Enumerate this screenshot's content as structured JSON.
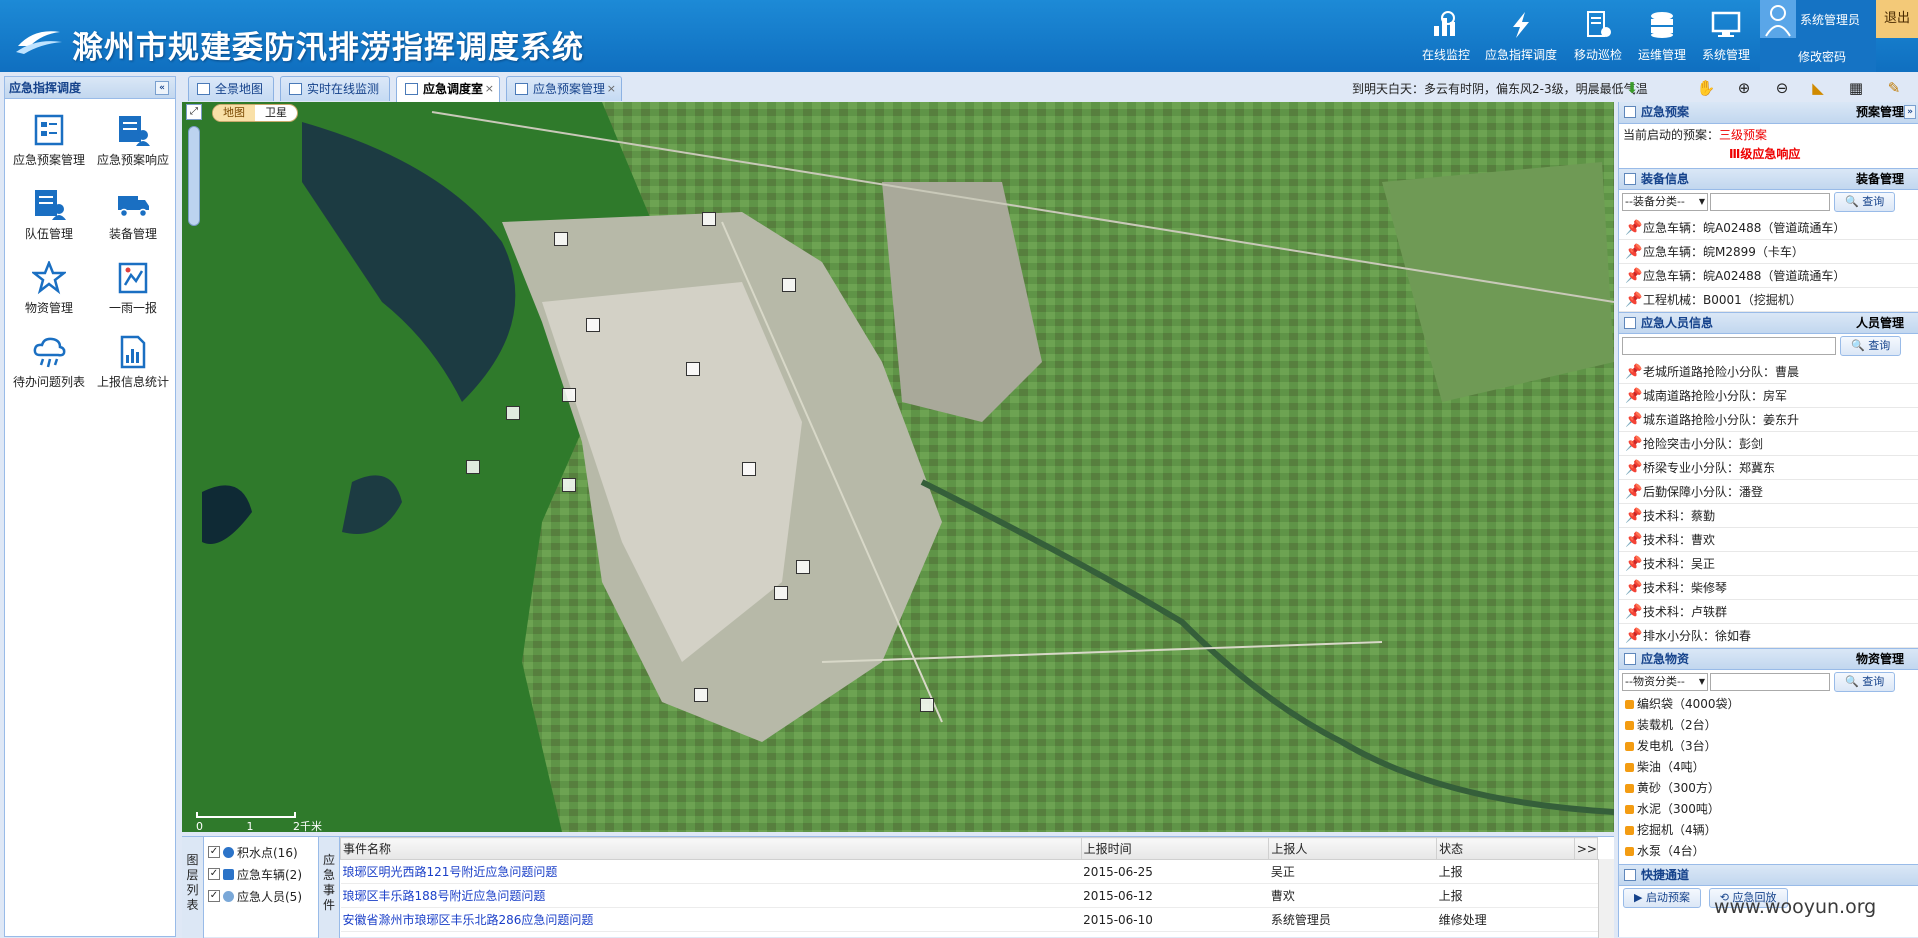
{
  "header": {
    "title": "滁州市规建委防汛排涝指挥调度系统",
    "nav": [
      {
        "label": "在线监控",
        "icon": "monitor-chart-icon"
      },
      {
        "label": "应急指挥调度",
        "icon": "lightning-icon"
      },
      {
        "label": "移动巡检",
        "icon": "mobile-inspect-icon"
      },
      {
        "label": "运维管理",
        "icon": "database-icon"
      },
      {
        "label": "系统管理",
        "icon": "computer-icon"
      }
    ],
    "user": "系统管理员",
    "change_password": "修改密码",
    "logout": "退出"
  },
  "left_panel": {
    "title": "应急指挥调度",
    "items": [
      {
        "label": "应急预案管理",
        "icon": "plan-doc-icon"
      },
      {
        "label": "应急预案响应",
        "icon": "plan-response-icon"
      },
      {
        "label": "队伍管理",
        "icon": "team-icon"
      },
      {
        "label": "装备管理",
        "icon": "truck-icon"
      },
      {
        "label": "物资管理",
        "icon": "star-icon"
      },
      {
        "label": "一雨一报",
        "icon": "rain-report-icon"
      },
      {
        "label": "待办问题列表",
        "icon": "cloud-rain-icon"
      },
      {
        "label": "上报信息统计",
        "icon": "stats-chart-icon"
      }
    ]
  },
  "tabs": [
    {
      "label": "全景地图",
      "closable": false
    },
    {
      "label": "实时在线监测",
      "closable": false
    },
    {
      "label": "应急调度室",
      "closable": true,
      "active": true
    },
    {
      "label": "应急预案管理",
      "closable": true
    }
  ],
  "weather": "到明天白天：多云有时阴，偏东风2-3级，明晨最低气温",
  "map": {
    "toggle": [
      "地图",
      "卫星"
    ],
    "active_toggle": "地图",
    "scale_labels": [
      "0",
      "1",
      "2千米"
    ]
  },
  "bottom": {
    "layer_title": "图层列表",
    "layers": [
      {
        "label": "积水点(16)",
        "checked": true
      },
      {
        "label": "应急车辆(2)",
        "checked": true
      },
      {
        "label": "应急人员(5)",
        "checked": true
      }
    ],
    "event_title": "应急事件",
    "columns": [
      "事件名称",
      "上报时间",
      "上报人",
      "状态",
      ">>"
    ],
    "rows": [
      {
        "name": "琅琊区明光西路121号附近应急问题问题",
        "time": "2015-06-25",
        "reporter": "吴正",
        "status": "上报"
      },
      {
        "name": "琅琊区丰乐路188号附近应急问题问题",
        "time": "2015-06-12",
        "reporter": "曹欢",
        "status": "上报"
      },
      {
        "name": "安徽省滁州市琅琊区丰乐北路286应急问题问题",
        "time": "2015-06-10",
        "reporter": "系统管理员",
        "status": "维修处理"
      }
    ]
  },
  "right_panel": {
    "plan": {
      "title": "应急预案",
      "link": "预案管理",
      "current_label": "当前启动的预案：",
      "current_value": "三级预案",
      "response": "Ⅲ级应急响应"
    },
    "equipment": {
      "title": "装备信息",
      "link": "装备管理",
      "select": "--装备分类--",
      "query": "查询",
      "items": [
        "应急车辆：皖A02488（管道疏通车）",
        "应急车辆：皖M2899（卡车）",
        "应急车辆：皖A02488（管道疏通车）",
        "工程机械：B0001（挖掘机）"
      ]
    },
    "personnel": {
      "title": "应急人员信息",
      "link": "人员管理",
      "query": "查询",
      "items": [
        "老城所道路抢险小分队：曹晨",
        "城南道路抢险小分队：房军",
        "城东道路抢险小分队：姜东升",
        "抢险突击小分队：彭剑",
        "桥梁专业小分队：郑冀东",
        "后勤保障小分队：潘登",
        "技术科：蔡勤",
        "技术科：曹欢",
        "技术科：吴正",
        "技术科：柴修琴",
        "技术科：卢轶群",
        "排水小分队：徐如春"
      ]
    },
    "materials": {
      "title": "应急物资",
      "link": "物资管理",
      "select": "--物资分类--",
      "query": "查询",
      "items": [
        "编织袋（4000袋）",
        "装载机（2台）",
        "发电机（3台）",
        "柴油（4吨）",
        "黄砂（300方）",
        "水泥（300吨）",
        "挖掘机（4辆）",
        "水泵（4台）"
      ]
    },
    "quick": {
      "title": "快捷通道",
      "buttons": [
        "启动预案",
        "应急回放"
      ]
    }
  },
  "watermark": "www.wooyun.org"
}
